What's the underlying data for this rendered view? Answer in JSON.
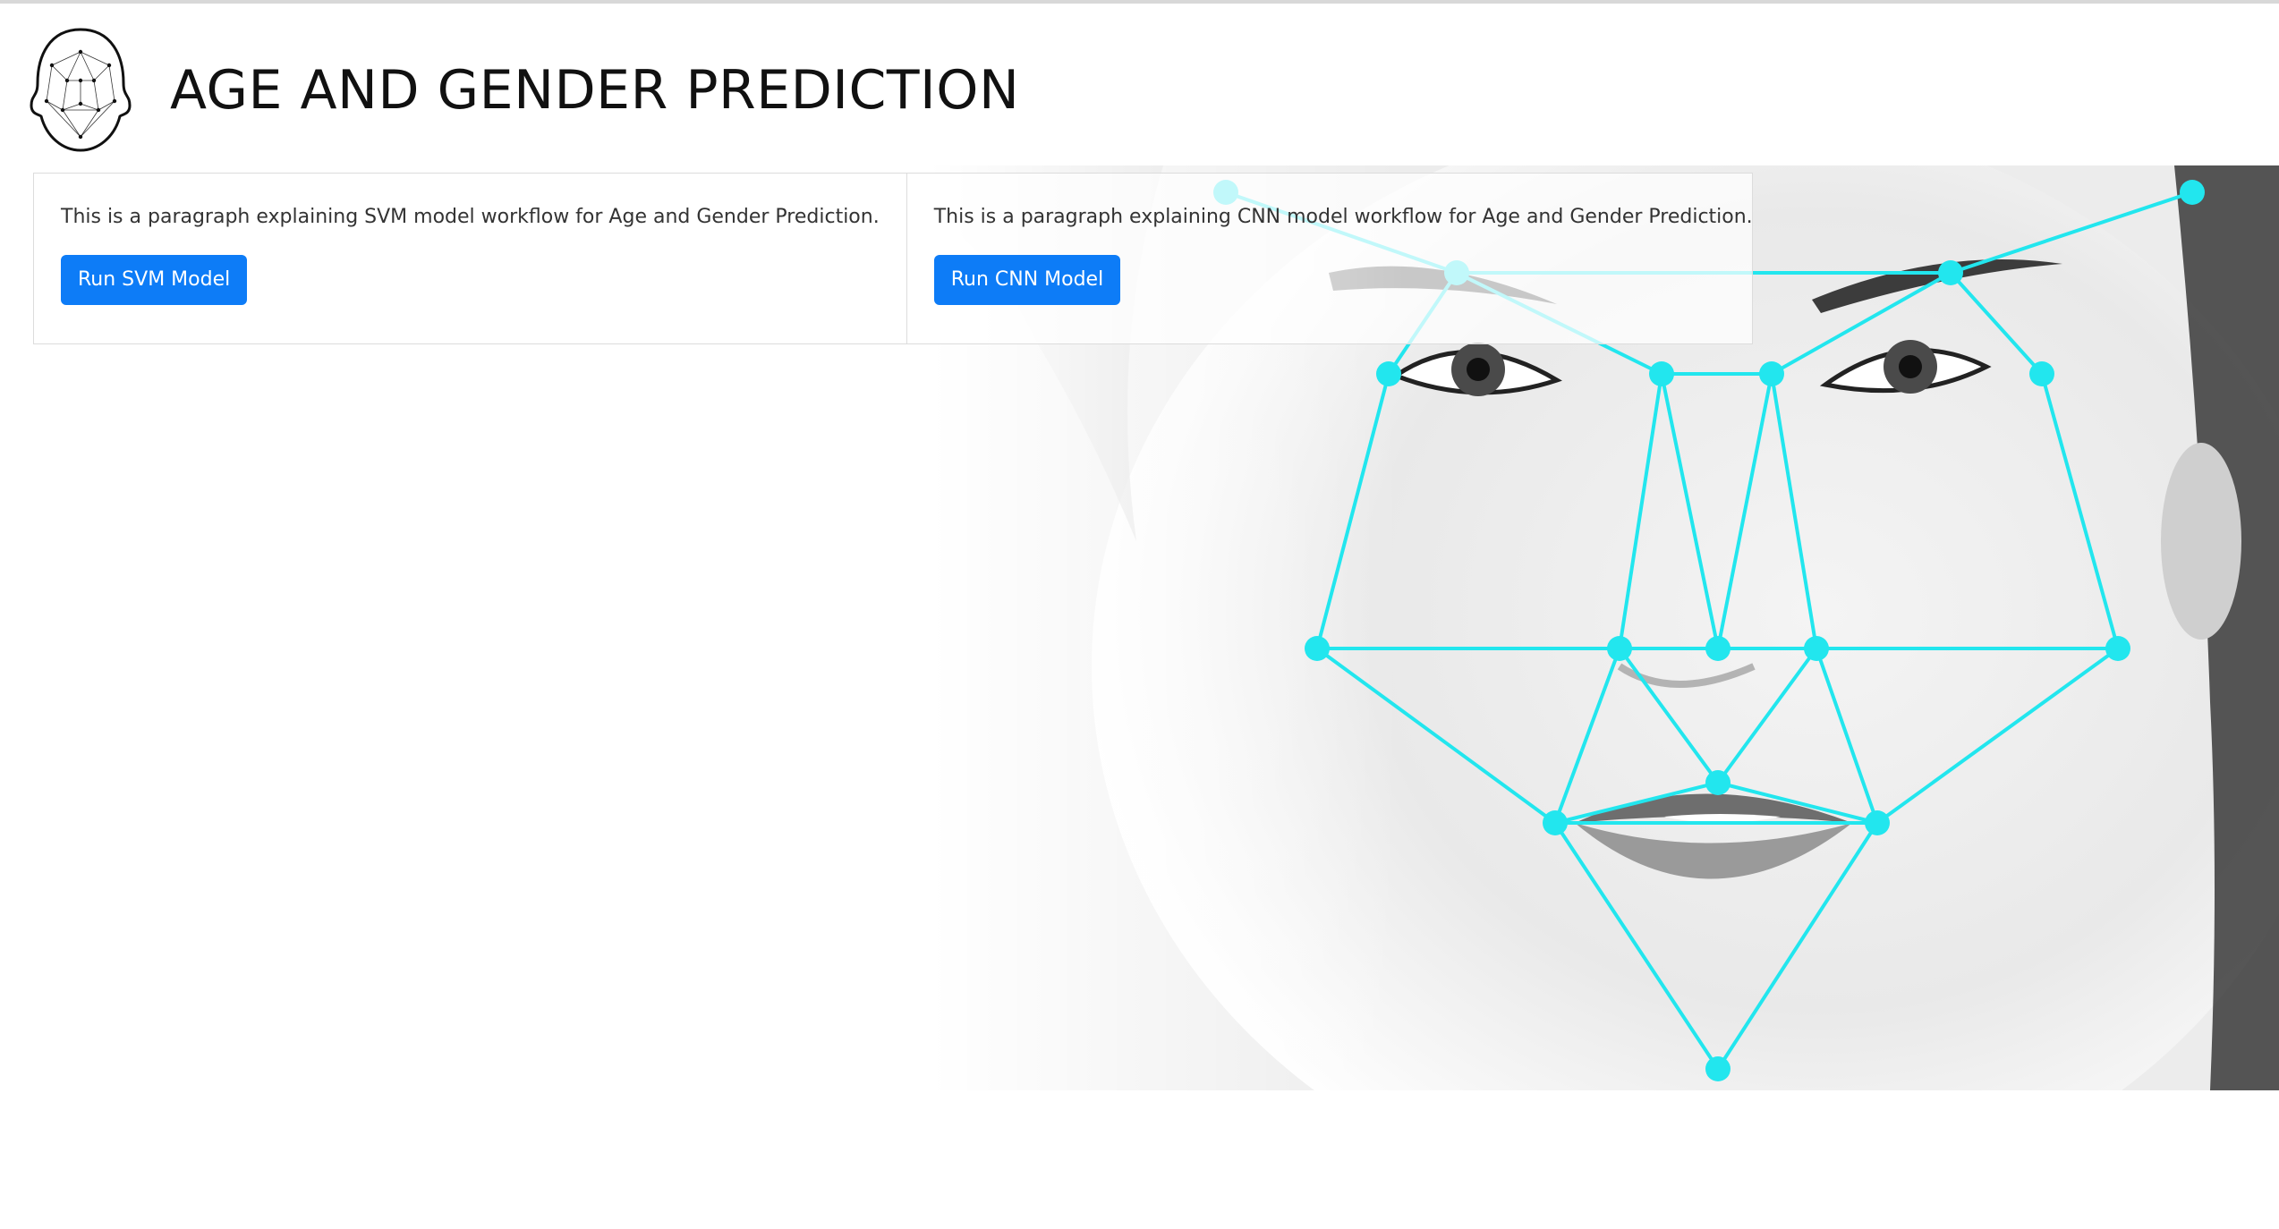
{
  "header": {
    "logo_icon": "face-mesh-icon",
    "title": "AGE AND GENDER PREDICTION"
  },
  "cards": [
    {
      "text": "This is a paragraph explaining SVM model workflow for Age and Gender Prediction.",
      "button_label": "Run SVM Model"
    },
    {
      "text": "This is a paragraph explaining CNN model workflow for Age and Gender Prediction.",
      "button_label": "Run CNN Model"
    }
  ],
  "hero": {
    "image": "face-landmark-mesh-photo",
    "mesh_color": "#22e6ee"
  },
  "colors": {
    "button_bg": "#0d7cf7",
    "button_text": "#ffffff",
    "mesh": "#22e6ee"
  }
}
